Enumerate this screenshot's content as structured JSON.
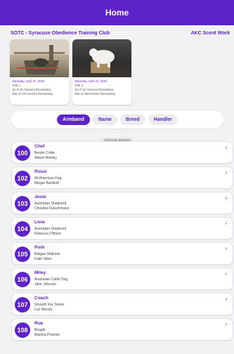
{
  "header": {
    "title": "Home"
  },
  "club": {
    "name": "SOTC - Syracuse Obedience Training Club",
    "side": "AKC Scent Work"
  },
  "trials": [
    {
      "date": "Saturday, April 27, 2024",
      "trial": "Trial 1",
      "classes": "16 of 16 Classes Remaining",
      "entries": "356 of 376 Entries Remaining"
    },
    {
      "date": "Saturday, April 27, 2024",
      "trial": "Trial 2",
      "classes": "16 of 16 Classes Remaining",
      "entries": "359 of 359 Entries Remaining"
    }
  ],
  "tabs": [
    {
      "label": "Armband",
      "active": true
    },
    {
      "label": "Name",
      "active": false
    },
    {
      "label": "Breed",
      "active": false
    },
    {
      "label": "Handler",
      "active": false
    }
  ],
  "dogs_count": "128 Dogs Entered",
  "dogs": [
    {
      "armband": "100",
      "name": "Chef",
      "breed": "Border Collie",
      "handler": "Allison Bickley"
    },
    {
      "armband": "102",
      "name": "Rossi",
      "breed": "All American Dog",
      "handler": "Megan Banfield"
    },
    {
      "armband": "103",
      "name": "Josie",
      "breed": "Australian Shepherd",
      "handler": "Christine Fleischmann"
    },
    {
      "armband": "104",
      "name": "Livie",
      "breed": "Australian Shepherd",
      "handler": "Rebecca O'Brien"
    },
    {
      "armband": "105",
      "name": "Pork",
      "breed": "Belgian Malinois",
      "handler": "Faith Stiles"
    },
    {
      "armband": "106",
      "name": "Miley",
      "breed": "Australian Cattle Dog",
      "handler": "Jane Johnson"
    },
    {
      "armband": "107",
      "name": "Coach",
      "breed": "Smooth Fox Terrier",
      "handler": "Lori Woods"
    },
    {
      "armband": "108",
      "name": "Rue",
      "breed": "Beagle",
      "handler": "Marsha Pivarnik"
    }
  ],
  "icons": {
    "row_chevron": "chevron-right-icon"
  },
  "colors": {
    "accent": "#5e22c9"
  }
}
